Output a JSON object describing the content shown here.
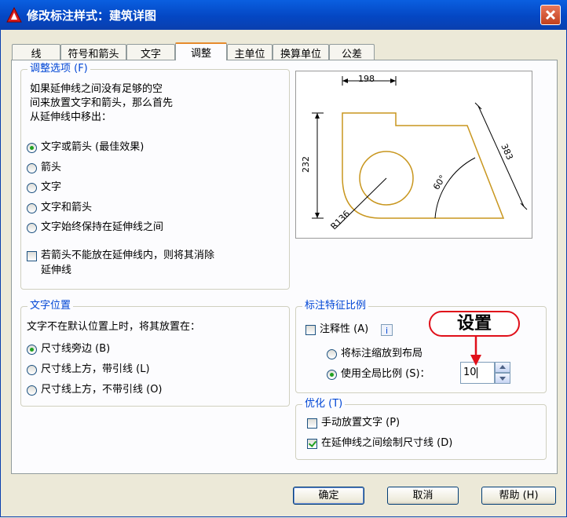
{
  "window": {
    "title": "修改标注样式：建筑详图"
  },
  "tabs": [
    {
      "label": "线"
    },
    {
      "label": "符号和箭头"
    },
    {
      "label": "文字"
    },
    {
      "label": "调整"
    },
    {
      "label": "主单位"
    },
    {
      "label": "换算单位"
    },
    {
      "label": "公差"
    }
  ],
  "fit_options": {
    "title": "调整选项 (F)",
    "description": [
      "如果延伸线之间没有足够的空",
      "间来放置文字和箭头，那么首先",
      "从延伸线中移出："
    ],
    "options": [
      "文字或箭头 (最佳效果)",
      "箭头",
      "文字",
      "文字和箭头",
      "文字始终保持在延伸线之间"
    ],
    "selected_index": 0,
    "suppress_label": [
      "若箭头不能放在延伸线内，则将其消除",
      "延伸线"
    ],
    "suppress_checked": false
  },
  "text_placement": {
    "title": "文字位置",
    "description": "文字不在默认位置上时，将其放置在：",
    "options": [
      "尺寸线旁边 (B)",
      "尺寸线上方，带引线 (L)",
      "尺寸线上方，不带引线 (O)"
    ],
    "selected_index": 0
  },
  "scale": {
    "title": "标注特征比例",
    "annotative_label": "注释性 (A)",
    "annotative_checked": false,
    "info_icon": "i",
    "layout_label": "将标注缩放到布局",
    "global_label": "使用全局比例 (S)：",
    "selected": "global",
    "global_value": "10"
  },
  "fine_tuning": {
    "title": "优化 (T)",
    "manual_label": "手动放置文字 (P)",
    "manual_checked": false,
    "draw_dim_label": "在延伸线之间绘制尺寸线 (D)",
    "draw_dim_checked": true
  },
  "preview": {
    "labels": {
      "width": "198",
      "height": "232",
      "slant": "383",
      "angle": "60°",
      "radius": "R136"
    }
  },
  "annotation": {
    "callout": "设置"
  },
  "buttons": {
    "ok": "确定",
    "cancel": "取消",
    "help": "帮助 (H)"
  },
  "colors": {
    "accent": "#0046d5",
    "tab_highlight": "#e68b2c",
    "preview_shape": "#c8961e",
    "callout": "#e0101a"
  }
}
